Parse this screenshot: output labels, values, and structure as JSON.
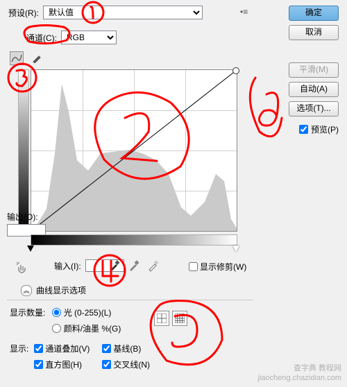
{
  "preset_label": "预设(R):",
  "preset_value": "默认值",
  "channel_label": "通道(C):",
  "channel_value": "RGB",
  "buttons": {
    "ok": "确定",
    "cancel": "取消",
    "smooth": "平滑(M)",
    "auto": "自动(A)",
    "options": "选项(T)..."
  },
  "preview_label": "预览(P)",
  "output_label": "输出(O):",
  "input_label": "输入(I):",
  "show_clip": "显示修剪(W)",
  "curve_disp": "曲线显示选项",
  "count_label": "显示数量:",
  "radio_light": "光 (0-255)(L)",
  "radio_pigment": "颜料/油墨 %(G)",
  "show_label": "显示:",
  "checks": {
    "overlay": "通道叠加(V)",
    "baseline": "基线(B)",
    "hist": "直方图(H)",
    "inter": "交叉线(N)"
  },
  "watermark": {
    "l1": "查字典  教程网",
    "l2": "jiaocheng.chazidian.com"
  },
  "chart_data": {
    "type": "curves-histogram",
    "x_range": [
      0,
      255
    ],
    "y_range": [
      0,
      255
    ],
    "curve": [
      [
        0,
        0
      ],
      [
        255,
        255
      ]
    ],
    "grid": "4x4",
    "histogram_peaks": [
      {
        "x": 40,
        "h": 0.95
      },
      {
        "x": 100,
        "h": 0.55
      },
      {
        "x": 150,
        "h": 0.5
      },
      {
        "x": 230,
        "h": 0.35
      }
    ]
  }
}
